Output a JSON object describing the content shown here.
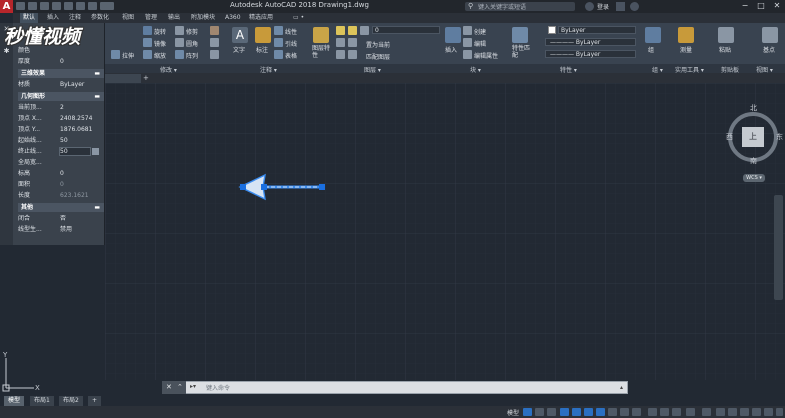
{
  "app": {
    "logo_letter": "A",
    "window_title": "Autodesk AutoCAD 2018    Drawing1.dwg",
    "search_placeholder": "键入关键字或短语",
    "login": "登录",
    "min": "−",
    "max": "□",
    "close": "✕"
  },
  "watermark": "秒懂视频",
  "menu_tabs": [
    "默认",
    "插入",
    "注释",
    "参数化",
    "视图",
    "管理",
    "输出",
    "附加模块",
    "A360",
    "精选应用",
    "▭ •"
  ],
  "ribbon": {
    "panel_labels": [
      "修改 ▾",
      "注释 ▾",
      "图层 ▾",
      "块 ▾",
      "特性 ▾",
      "组 ▾",
      "实用工具 ▾",
      "剪贴板",
      "视图 ▾"
    ],
    "modify_tools": [
      "旋转",
      "修剪",
      "镜像",
      "圆角",
      "拉伸",
      "缩放",
      "阵列"
    ],
    "annotation_tools": [
      "文字",
      "标注",
      "线性",
      "引线",
      "表格"
    ],
    "layer_tools": [
      "图层特性",
      "置为当前",
      "匹配图层"
    ],
    "layer_value": "0",
    "block_tools": [
      "插入",
      "创建",
      "编辑",
      "编辑属性"
    ],
    "props_tools": [
      "特性匹配"
    ],
    "prop_values": [
      "ByLayer",
      "———— ByLayer",
      "———— ByLayer"
    ],
    "group_label": "组",
    "utilities_label": "测量",
    "paste_label": "粘贴",
    "base_label": "基点"
  },
  "file_tab_add": "+",
  "palette": {
    "rows_top": [
      {
        "label": "颜色",
        "value": ""
      },
      {
        "label": "厚度",
        "value": "0"
      }
    ],
    "section_3d": "三维效果",
    "material_label": "材质",
    "material_value": "ByLayer",
    "section_geometry": "几何图形",
    "geometry_rows": [
      {
        "label": "当前顶...",
        "value": "2"
      },
      {
        "label": "顶点 X...",
        "value": "2408.2574"
      },
      {
        "label": "顶点 Y...",
        "value": "1876.0681"
      },
      {
        "label": "起始线...",
        "value": "50"
      },
      {
        "label": "终止线...",
        "value": "50"
      },
      {
        "label": "全局宽...",
        "value": ""
      },
      {
        "label": "标高",
        "value": "0"
      },
      {
        "label": "面积",
        "value": "0"
      },
      {
        "label": "长度",
        "value": "623.1621"
      }
    ],
    "section_other": "其他",
    "other_rows": [
      {
        "label": "闭合",
        "value": "否"
      },
      {
        "label": "线型生...",
        "value": "禁用"
      }
    ],
    "side_buttons": [
      "✕",
      "▪",
      "✱"
    ]
  },
  "viewcube": {
    "top_face": "上",
    "north": "北",
    "south": "南",
    "east": "东",
    "west": "西",
    "wcs": "WCS ▾"
  },
  "ucs": {
    "x": "X",
    "y": "Y"
  },
  "command": {
    "close": "✕",
    "history": "⌃",
    "prompt_icon": "▸▾",
    "placeholder": "键入命令"
  },
  "layout_tabs": [
    "模型",
    "布局1",
    "布局2",
    "+"
  ],
  "status": {
    "model_label": "模型"
  },
  "colors": {
    "canvas_bg": "#222933",
    "selection_blue": "#2f7fe0",
    "grip_blue": "#1a6fe0"
  }
}
